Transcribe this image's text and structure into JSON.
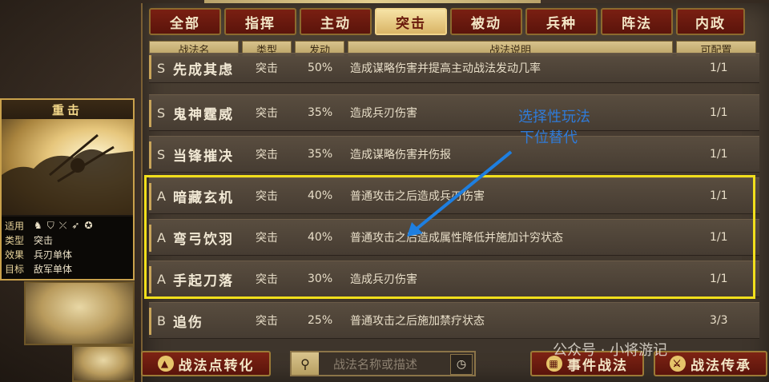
{
  "tabs": [
    "全部",
    "指挥",
    "主动",
    "突击",
    "被动",
    "兵种",
    "阵法",
    "内政"
  ],
  "active_tab": "突击",
  "columns": {
    "name": "战法名",
    "type": "类型",
    "rate": "发动",
    "desc": "战法说明",
    "qty": "可配置"
  },
  "rows": [
    {
      "grade": "S",
      "name": "先成其虑",
      "type": "突击",
      "rate": "50%",
      "desc": "造成谋略伤害并提高主动战法发动几率",
      "qty": "1/1"
    },
    {
      "grade": "S",
      "name": "鬼神霆威",
      "type": "突击",
      "rate": "35%",
      "desc": "造成兵刃伤害",
      "qty": "1/1"
    },
    {
      "grade": "S",
      "name": "当锋摧决",
      "type": "突击",
      "rate": "35%",
      "desc": "造成谋略伤害并伤报",
      "qty": "1/1"
    },
    {
      "grade": "A",
      "name": "暗藏玄机",
      "type": "突击",
      "rate": "40%",
      "desc": "普通攻击之后造成兵刃伤害",
      "qty": "1/1"
    },
    {
      "grade": "A",
      "name": "弯弓饮羽",
      "type": "突击",
      "rate": "40%",
      "desc": "普通攻击之后造成属性降低并施加计穷状态",
      "qty": "1/1"
    },
    {
      "grade": "A",
      "name": "手起刀落",
      "type": "突击",
      "rate": "30%",
      "desc": "造成兵刃伤害",
      "qty": "1/1"
    },
    {
      "grade": "B",
      "name": "追伤",
      "type": "突击",
      "rate": "25%",
      "desc": "普通攻击之后施加禁疗状态",
      "qty": "3/3"
    }
  ],
  "annotation": {
    "line1": "选择性玩法",
    "line2": "下位替代",
    "color": "#2f7bd9",
    "box_color": "#f1df1c"
  },
  "card": {
    "title": "重击",
    "labels": {
      "apply": "适用",
      "kind": "类型",
      "effect": "效果",
      "target": "目标"
    },
    "values": {
      "kind": "突击",
      "effect": "兵刃单体",
      "target": "敌军单体"
    },
    "icons": [
      "horse-icon",
      "shield-icon",
      "bow-icon",
      "spear-icon",
      "wheel-icon"
    ]
  },
  "buttons": {
    "convert": "战法点转化",
    "event": "事件战法",
    "inherit": "战法传承"
  },
  "search": {
    "placeholder": "战法名称或描述"
  },
  "watermark": "公众号 · 小将游记"
}
